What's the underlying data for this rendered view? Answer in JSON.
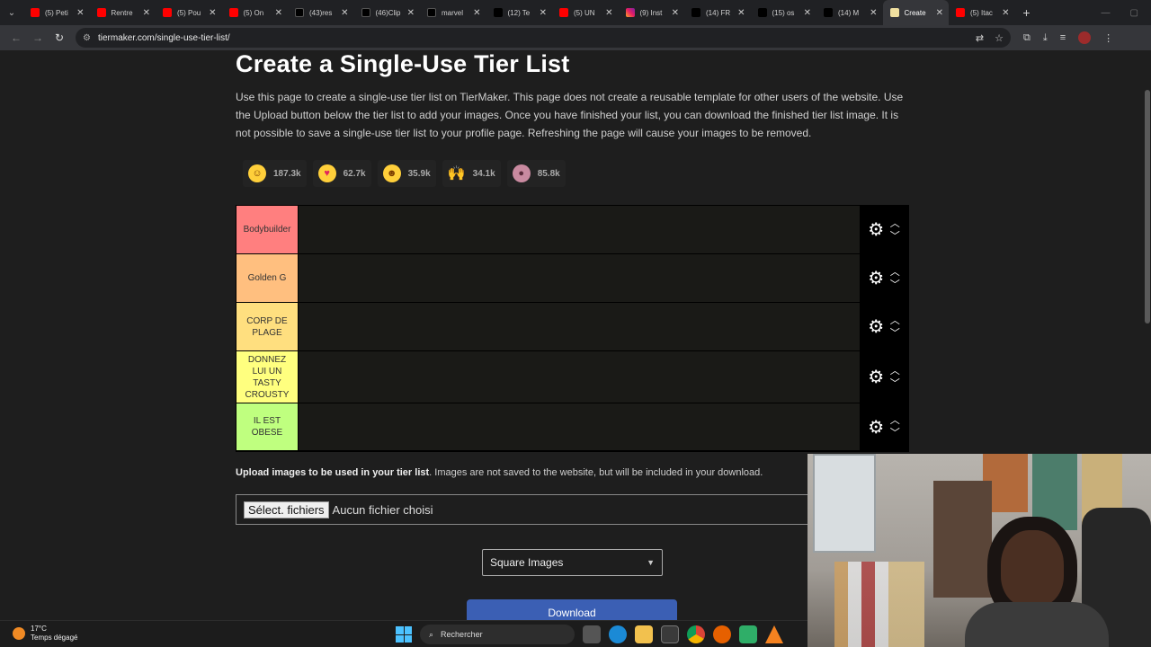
{
  "browser": {
    "tabs": [
      {
        "label": "(5) Peti",
        "fav": "yt"
      },
      {
        "label": "Rentre",
        "fav": "yt"
      },
      {
        "label": "(5) Pou",
        "fav": "yt"
      },
      {
        "label": "(5) On",
        "fav": "yt"
      },
      {
        "label": "(43)res",
        "fav": "tk"
      },
      {
        "label": "(46)Clip",
        "fav": "tk"
      },
      {
        "label": "marvel",
        "fav": "tk"
      },
      {
        "label": "(12) Te",
        "fav": "x"
      },
      {
        "label": "(5) UN",
        "fav": "yt"
      },
      {
        "label": "(9) Inst",
        "fav": "ig"
      },
      {
        "label": "(14) FR",
        "fav": "x"
      },
      {
        "label": "(15) os",
        "fav": "x"
      },
      {
        "label": "(14) M",
        "fav": "x"
      },
      {
        "label": "Create",
        "fav": "tm",
        "active": true
      },
      {
        "label": "(5) Itac",
        "fav": "yt"
      }
    ],
    "url": "tiermaker.com/single-use-tier-list/"
  },
  "page": {
    "title": "Create a Single-Use Tier List",
    "description": "Use this page to create a single-use tier list on TierMaker. This page does not create a reusable template for other users of the website. Use the Upload button below the tier list to add your images. Once you have finished your list, you can download the finished tier list image. It is not possible to save a single-use tier list to your profile page. Refreshing the page will cause your images to be removed.",
    "reactions": [
      {
        "icon": "grinning-face-icon",
        "count": "187.3k"
      },
      {
        "icon": "heart-eyes-face-icon",
        "count": "62.7k"
      },
      {
        "icon": "laughing-face-icon",
        "count": "35.9k"
      },
      {
        "icon": "raised-hands-icon",
        "count": "34.1k"
      },
      {
        "icon": "poop-icon",
        "count": "85.8k"
      }
    ],
    "tiers": [
      {
        "label": "Bodybuilder",
        "color": "#ff7f7f"
      },
      {
        "label": "Golden G",
        "color": "#ffbf7f"
      },
      {
        "label": "CORP DE PLAGE",
        "color": "#ffdf7f"
      },
      {
        "label": "DONNEZ LUI UN TASTY CROUSTY",
        "color": "#ffff7f"
      },
      {
        "label": "IL EST OBESE",
        "color": "#bfff7f"
      }
    ],
    "upload_bold": "Upload images to be used in your tier list",
    "upload_rest": ". Images are not saved to the website, but will be included in your download.",
    "file_button": "Sélect. fichiers",
    "file_status": "Aucun fichier choisi",
    "image_mode": "Square Images",
    "download_label": "Download"
  },
  "taskbar": {
    "temperature": "17°C",
    "weather": "Temps dégagé",
    "search_placeholder": "Rechercher"
  }
}
